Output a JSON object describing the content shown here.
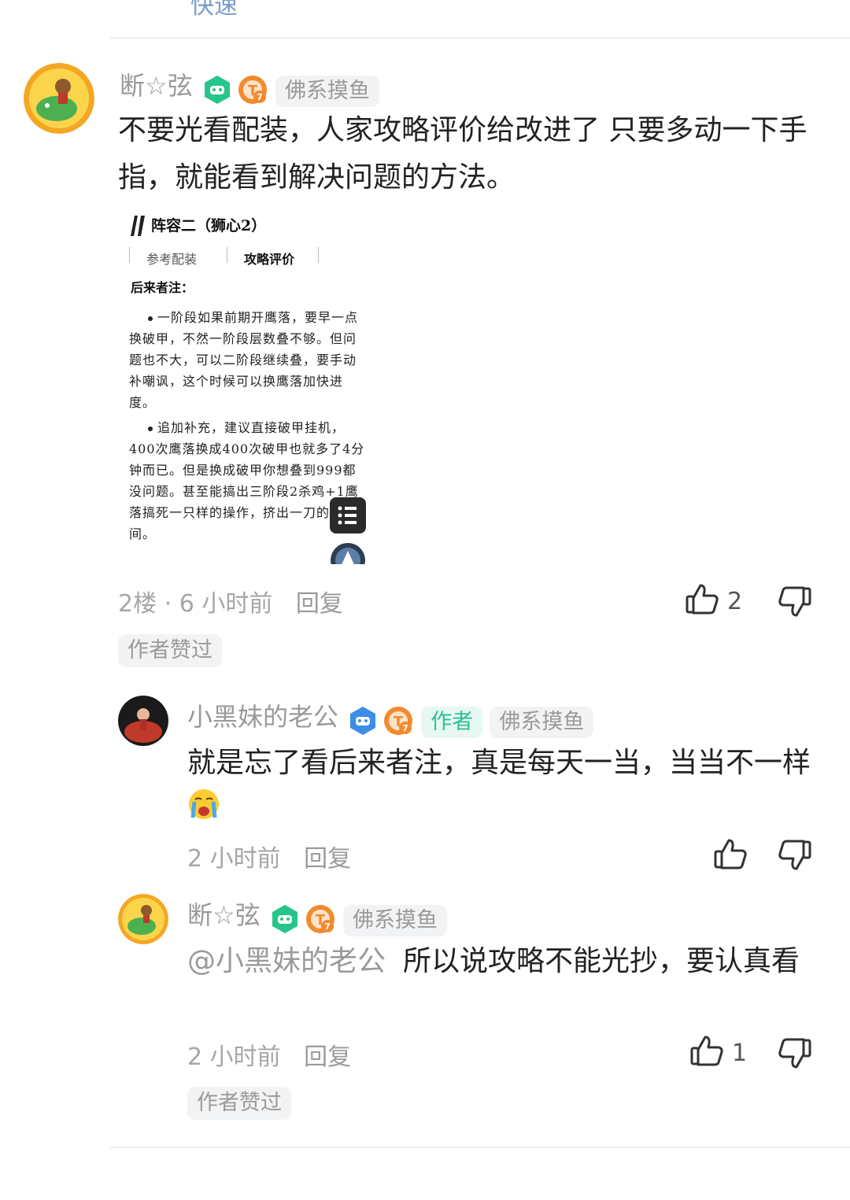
{
  "top_cut_text": "快速",
  "comments": [
    {
      "username": "断☆弦",
      "tag": "佛系摸鱼",
      "text": "不要光看配装，人家攻略评价给改进了    只要多动一下手指，就能看到解决问题的方法。",
      "screenshot": {
        "title": "阵容二（狮心2）",
        "tab1": "参考配装",
        "tab2": "攻略评价",
        "note_label": "后来者注：",
        "bullet1": "一阶段如果前期开鹰落，要早一点换破甲，不然一阶段层数叠不够。但问题也不大，可以二阶段继续叠，要手动补嘲讽，这个时候可以换鹰落加快进度。",
        "bullet2": "追加补充，建议直接破甲挂机，400次鹰落换成400次破甲也就多了4分钟而已。但是换成破甲你想叠到999都没问题。甚至能搞出三阶段2杀鸡+1鹰落搞死一只样的操作，挤出一刀的空间。"
      },
      "floor": "2楼",
      "time": "6 小时前",
      "reply": "回复",
      "likes": "2",
      "liked_by_author": "作者赞过"
    },
    {
      "username": "小黑妹的老公",
      "author_tag": "作者",
      "tag": "佛系摸鱼",
      "text": "就是忘了看后来者注，真是每天一当，当当不一样",
      "time": "2 小时前",
      "reply": "回复"
    },
    {
      "username": "断☆弦",
      "tag": "佛系摸鱼",
      "mention": "@小黑妹的老公",
      "text": "所以说攻略不能光抄，要认真看",
      "time": "2 小时前",
      "reply": "回复",
      "likes": "1",
      "liked_by_author": "作者赞过"
    }
  ],
  "icons": {
    "like": "thumbs-up-icon",
    "dislike": "thumbs-down-icon",
    "game_badge": "gamepad-badge-icon",
    "level_badge": "level-7-badge-icon",
    "menu": "list-menu-icon",
    "emoji": "crying-emoji-icon"
  },
  "colors": {
    "game_badge": "#26c58a",
    "level_badge": "#f28a2e",
    "author_tag_text": "#2fbf96",
    "author_tag_bg": "#e7f8f3",
    "meta_text": "#a6a6a6"
  }
}
